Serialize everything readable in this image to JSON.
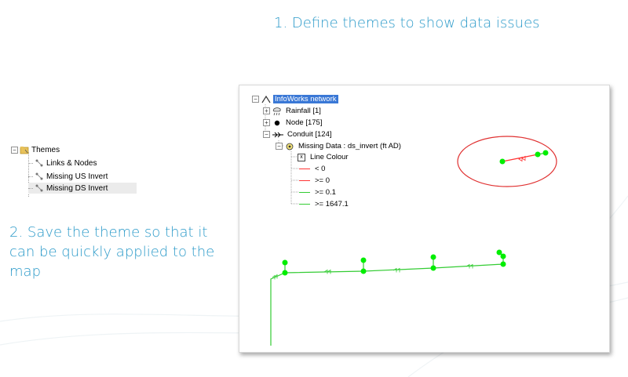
{
  "step1": "1. Define themes to show data issues",
  "step2": "2. Save the theme so that it can be quickly applied to the map",
  "themes_panel": {
    "root_label": "Themes",
    "items": [
      {
        "label": "Links & Nodes"
      },
      {
        "label": "Missing US Invert"
      },
      {
        "label": "Missing DS Invert"
      }
    ]
  },
  "network_tree": {
    "root": "InfoWorks network",
    "rainfall": "Rainfall [1]",
    "node": "Node [175]",
    "conduit": "Conduit [124]",
    "theme": "Missing Data : ds_invert (ft AD)",
    "line_colour": "Line Colour",
    "legend": [
      {
        "label": "< 0",
        "color": "#ff3333"
      },
      {
        "label": ">= 0",
        "color": "#ff3333"
      },
      {
        "label": ">= 0.1",
        "color": "#33cc33"
      },
      {
        "label": ">= 1647.1",
        "color": "#33cc33"
      }
    ]
  },
  "colors": {
    "accent": "#2b9ac9",
    "node_green": "#00ee00",
    "highlight_ring": "#e03030",
    "selection": "#3a78d6"
  }
}
